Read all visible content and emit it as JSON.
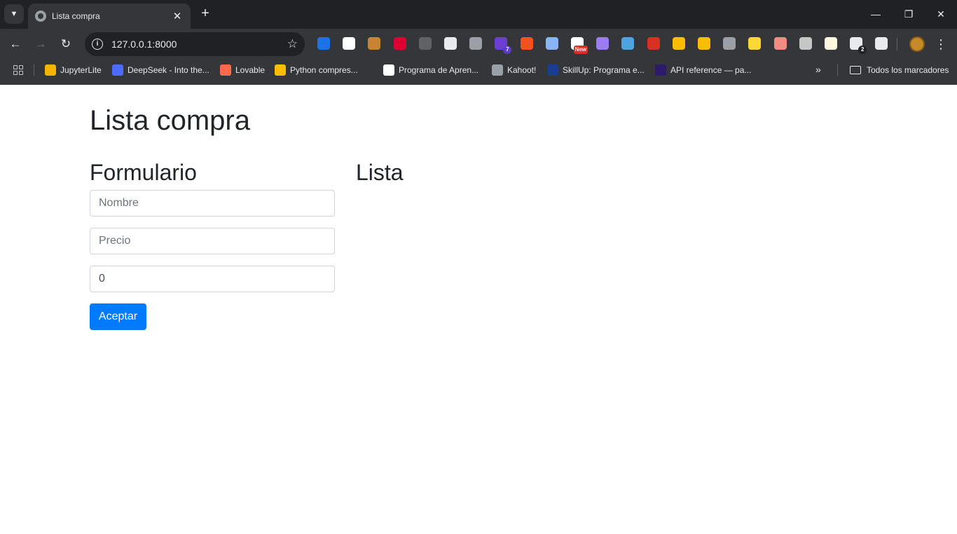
{
  "browser": {
    "tab": {
      "title": "Lista compra",
      "icon": "globe-icon"
    },
    "url": "127.0.0.1:8000",
    "extensions": [
      {
        "name": "r-extension-icon",
        "color": "#1a73e8",
        "badge": ""
      },
      {
        "name": "eyedropper-icon",
        "color": "#ffffff",
        "badge": ""
      },
      {
        "name": "cookie-icon",
        "color": "#c8852f",
        "badge": ""
      },
      {
        "name": "angular-icon",
        "color": "#dd0031",
        "badge": ""
      },
      {
        "name": "java-icon",
        "color": "#5f6368",
        "badge": ""
      },
      {
        "name": "react-icon",
        "color": "#e8eaed",
        "badge": ""
      },
      {
        "name": "vue-icon",
        "color": "#9aa0a6",
        "badge": ""
      },
      {
        "name": "stack-icon",
        "color": "#6a3fd1",
        "badge": "7"
      },
      {
        "name": "yc-icon",
        "color": "#f4511e",
        "badge": ""
      },
      {
        "name": "circle-icon",
        "color": "#8ab4f8",
        "badge": ""
      },
      {
        "name": "new-extension-icon",
        "color": "#ffffff",
        "badge": "New"
      },
      {
        "name": "feather-icon",
        "color": "#9c7cf4",
        "badge": ""
      },
      {
        "name": "vimeo-icon",
        "color": "#4fa3e0",
        "badge": ""
      },
      {
        "name": "s-extension-icon",
        "color": "#d93025",
        "badge": ""
      },
      {
        "name": "n-extension-icon",
        "color": "#fbbc04",
        "badge": ""
      },
      {
        "name": "bars-icon",
        "color": "#fbbc04",
        "badge": ""
      },
      {
        "name": "divider-icon",
        "color": "#9aa0a6",
        "badge": ""
      },
      {
        "name": "mask-icon",
        "color": "#fdd835",
        "badge": ""
      },
      {
        "name": "audio-icon",
        "color": "#f28b82",
        "badge": ""
      },
      {
        "name": "mouse-icon",
        "color": "#c4c7c5",
        "badge": ""
      },
      {
        "name": "note-icon",
        "color": "#fff8e1",
        "badge": ""
      },
      {
        "name": "clipboard-icon",
        "color": "#e8eaed",
        "badge": "2"
      },
      {
        "name": "puzzle-icon",
        "color": "#e8eaed",
        "badge": ""
      }
    ],
    "bookmarks": [
      {
        "label": "JupyterLite",
        "color": "#f4b400"
      },
      {
        "label": "DeepSeek - Into the...",
        "color": "#4d6bfe"
      },
      {
        "label": "Lovable",
        "color": "#ff6b4a"
      },
      {
        "label": "Python compres...",
        "color": "#fbbc04"
      },
      {
        "label": "Programa de Apren...",
        "color": "#ffffff"
      },
      {
        "label": "Kahoot!",
        "color": "#9aa0a6"
      },
      {
        "label": "SkillUp: Programa e...",
        "color": "#1a3d8f"
      },
      {
        "label": "API reference — pa...",
        "color": "#2d1b69"
      }
    ],
    "all_bookmarks": "Todos los marcadores"
  },
  "page": {
    "title": "Lista compra",
    "form": {
      "title": "Formulario",
      "name_placeholder": "Nombre",
      "price_placeholder": "Precio",
      "quantity_value": "0",
      "submit_label": "Aceptar"
    },
    "list": {
      "title": "Lista"
    },
    "primary_color": "#007bff"
  }
}
